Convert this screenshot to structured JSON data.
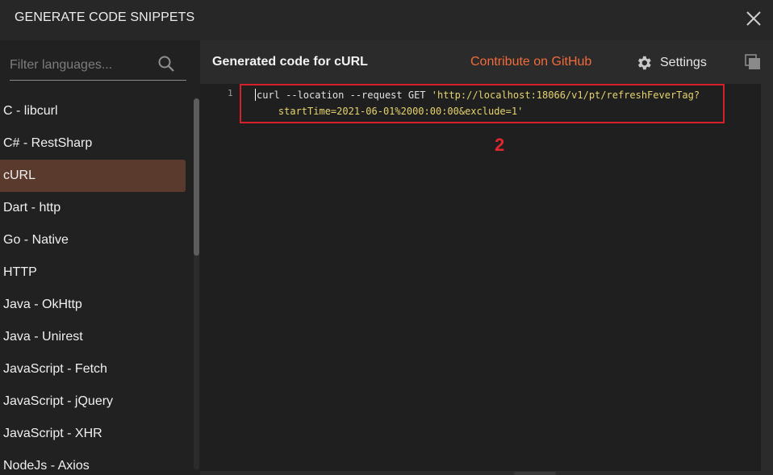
{
  "dialog": {
    "title": "GENERATE CODE SNIPPETS"
  },
  "sidebar": {
    "filter": {
      "placeholder": "Filter languages...",
      "value": ""
    },
    "items": [
      {
        "label": "C - libcurl",
        "active": false
      },
      {
        "label": "C# - RestSharp",
        "active": false
      },
      {
        "label": "cURL",
        "active": true
      },
      {
        "label": "Dart - http",
        "active": false
      },
      {
        "label": "Go - Native",
        "active": false
      },
      {
        "label": "HTTP",
        "active": false
      },
      {
        "label": "Java - OkHttp",
        "active": false
      },
      {
        "label": "Java - Unirest",
        "active": false
      },
      {
        "label": "JavaScript - Fetch",
        "active": false
      },
      {
        "label": "JavaScript - jQuery",
        "active": false
      },
      {
        "label": "JavaScript - XHR",
        "active": false
      },
      {
        "label": "NodeJs - Axios",
        "active": false
      }
    ]
  },
  "header": {
    "title": "Generated code for cURL",
    "github_link": "Contribute on GitHub",
    "settings_label": "Settings"
  },
  "editor": {
    "line_number": "1",
    "code_command": "curl --location --request GET ",
    "code_url_line1": "'http://localhost:18066/v1/pt/refreshFeverTag?",
    "code_url_line2": "    startTime=2021-06-01%2000:00:00&exclude=1'"
  },
  "annotation": {
    "label": "2"
  },
  "colors": {
    "accent": "#f26b3a",
    "active_item_bg": "#5b3a2e",
    "annotation_red": "#e0262e",
    "string": "#e6d46e"
  },
  "icons": {
    "close": "close-icon",
    "search": "search-icon",
    "settings": "gear-icon",
    "copy": "copy-icon"
  }
}
